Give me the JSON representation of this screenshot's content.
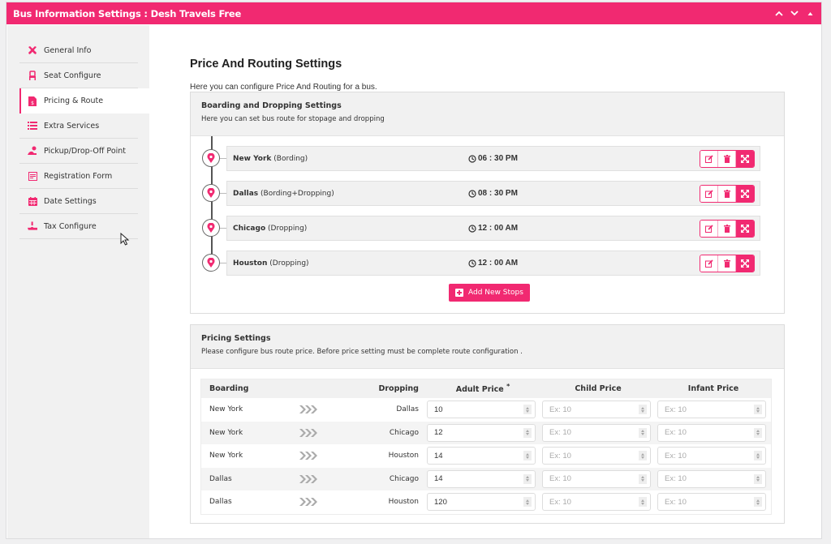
{
  "metabox": {
    "title": "Bus Information Settings : Desh Travels Free",
    "controls": [
      "move-up",
      "move-down",
      "collapse"
    ]
  },
  "sidebar": {
    "items": [
      {
        "label": "General Info",
        "icon": "tools-icon",
        "active": false
      },
      {
        "label": "Seat Configure",
        "icon": "seat-icon",
        "active": false
      },
      {
        "label": "Pricing & Route",
        "icon": "price-file-icon",
        "active": true
      },
      {
        "label": "Extra Services",
        "icon": "list-icon",
        "active": false
      },
      {
        "label": "Pickup/Drop-Off Point",
        "icon": "pickup-icon",
        "active": false
      },
      {
        "label": "Registration Form",
        "icon": "form-icon",
        "active": false
      },
      {
        "label": "Date Settings",
        "icon": "calendar-icon",
        "active": false
      },
      {
        "label": "Tax Configure",
        "icon": "tax-hand-icon",
        "active": false
      }
    ]
  },
  "main": {
    "title": "Price And Routing Settings",
    "description": "Here you can configure Price And Routing for a bus."
  },
  "routing": {
    "heading": "Boarding and Dropping Settings",
    "description": "Here you can set bus route for stopage and dropping",
    "stops": [
      {
        "name": "New York",
        "type": "(Bording)",
        "time": "06 : 30  PM"
      },
      {
        "name": "Dallas",
        "type": "(Bording+Dropping)",
        "time": "08 : 30  PM"
      },
      {
        "name": "Chicago",
        "type": "(Dropping)",
        "time": "12 : 00  AM"
      },
      {
        "name": "Houston",
        "type": "(Dropping)",
        "time": "12 : 00  AM"
      }
    ],
    "add_button": "Add New Stops"
  },
  "pricing": {
    "heading": "Pricing Settings",
    "description": "Please configure bus route price. Before price setting must be complete route configuration .",
    "columns": {
      "boarding": "Boarding",
      "dropping": "Dropping",
      "adult": "Adult Price",
      "adult_required": "*",
      "child": "Child Price",
      "infant": "Infant Price"
    },
    "placeholder": "Ex: 10",
    "rows": [
      {
        "boarding": "New York",
        "dropping": "Dallas",
        "adult": "10",
        "child": "",
        "infant": ""
      },
      {
        "boarding": "New York",
        "dropping": "Chicago",
        "adult": "12",
        "child": "",
        "infant": ""
      },
      {
        "boarding": "New York",
        "dropping": "Houston",
        "adult": "14",
        "child": "",
        "infant": ""
      },
      {
        "boarding": "Dallas",
        "dropping": "Chicago",
        "adult": "14",
        "child": "",
        "infant": ""
      },
      {
        "boarding": "Dallas",
        "dropping": "Houston",
        "adult": "120",
        "child": "",
        "infant": ""
      }
    ]
  },
  "colors": {
    "accent": "#f12971",
    "sidebar_bg": "#f1f1f1",
    "panel_head_bg": "#f1f1f1"
  }
}
